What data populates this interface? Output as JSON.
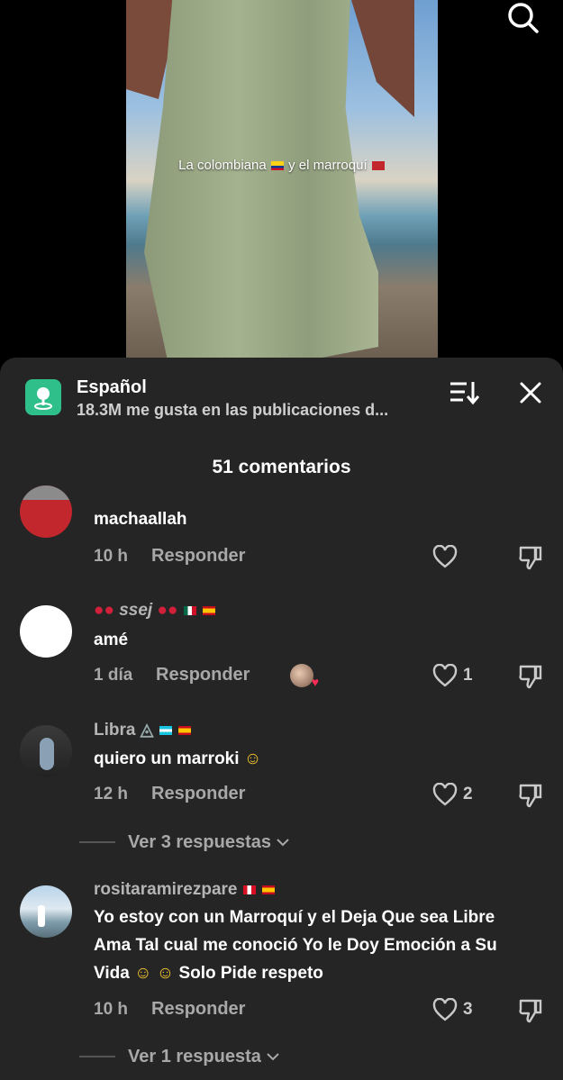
{
  "video": {
    "caption_text_1": "La colombiana",
    "caption_text_2": "y el marroquí"
  },
  "sheet": {
    "topic_title": "Español",
    "topic_subtitle": "18.3M me gusta en las publicaciones d...",
    "comment_count": "51 comentarios"
  },
  "comments": [
    {
      "username": "",
      "text": "machaallah",
      "time": "10 h",
      "reply_label": "Responder",
      "likes": ""
    },
    {
      "username_text": "ssej",
      "text": "amé",
      "time": "1 día",
      "reply_label": "Responder",
      "likes": "1"
    },
    {
      "username": "Libra",
      "text": "quiero un marroki",
      "time": "12 h",
      "reply_label": "Responder",
      "likes": "2",
      "more_replies": "Ver 3 respuestas"
    },
    {
      "username": "rositaramirezpare",
      "text": "Yo estoy con un Marroquí y el Deja Que sea Libre Ama Tal cual me conoció Yo le Doy Emoción a Su Vida",
      "text_tail": "Solo Pide respeto",
      "time": "10 h",
      "reply_label": "Responder",
      "likes": "3",
      "more_replies": "Ver 1 respuesta"
    }
  ],
  "colors": {
    "sheet_bg": "#252525",
    "topic_icon": "#2fbf8b",
    "like_heart": "#fe2c55"
  },
  "icons": [
    "search-icon",
    "location-pin-icon",
    "sort-icon",
    "close-icon",
    "heart-icon",
    "dislike-icon",
    "chevron-down-icon"
  ]
}
